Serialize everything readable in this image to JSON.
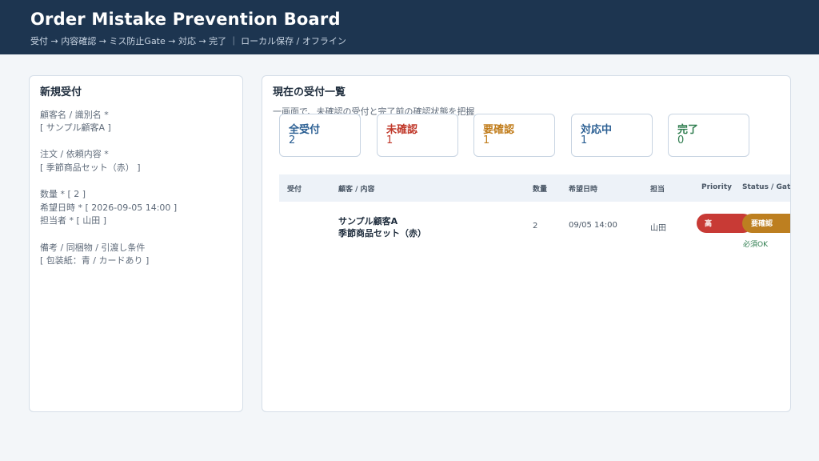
{
  "header": {
    "title": "Order Mistake Prevention Board",
    "subtitle": "受付 → 内容確認 → ミス防止Gate → 対応 → 完了 ｜ ローカル保存 / オフライン"
  },
  "new_order": {
    "title": "新規受付",
    "customer_label": "顧客名 / 識別名 *",
    "customer_value": "[ サンプル顧客A ]",
    "order_label": "注文 / 依頼内容 *",
    "order_value": "[ 季節商品セット（赤） ]",
    "quantity_line": "数量 *  [ 2 ]",
    "datetime_line": "希望日時 * [ 2026-09-05 14:00 ]",
    "assignee_line": "担当者 * [ 山田 ]",
    "notes_label": "備考 / 同梱物 / 引渡し条件",
    "notes_value": "[ 包装紙：青 / カードあり ]"
  },
  "board": {
    "title": "現在の受付一覧",
    "subtitle": "一画面で、未確認の受付と完了前の確認状態を把握",
    "stats": [
      {
        "label": "全受付",
        "count": "2",
        "color": "#2b5f93"
      },
      {
        "label": "未確認",
        "count": "1",
        "color": "#c0392b"
      },
      {
        "label": "要確認",
        "count": "1",
        "color": "#c17d1c"
      },
      {
        "label": "対応中",
        "count": "1",
        "color": "#2b5f93"
      },
      {
        "label": "完了",
        "count": "0",
        "color": "#2f7d4f"
      }
    ],
    "columns": [
      "受付",
      "顧客 / 内容",
      "数量",
      "希望日時",
      "担当",
      "Priority",
      "Status / Gate"
    ],
    "rows": [
      {
        "customer": "サンプル顧客A",
        "item": "季節商品セット（赤）",
        "quantity": "2",
        "datetime": "09/05 14:00",
        "assignee": "山田",
        "priority": "高",
        "status": "要確認",
        "gate": "必須OK"
      }
    ]
  },
  "colors": {
    "header_bg": "#1d3550",
    "priority_high": "#c83a35",
    "status_review": "#bd7f20",
    "gate_ok": "#2f7d4f"
  }
}
